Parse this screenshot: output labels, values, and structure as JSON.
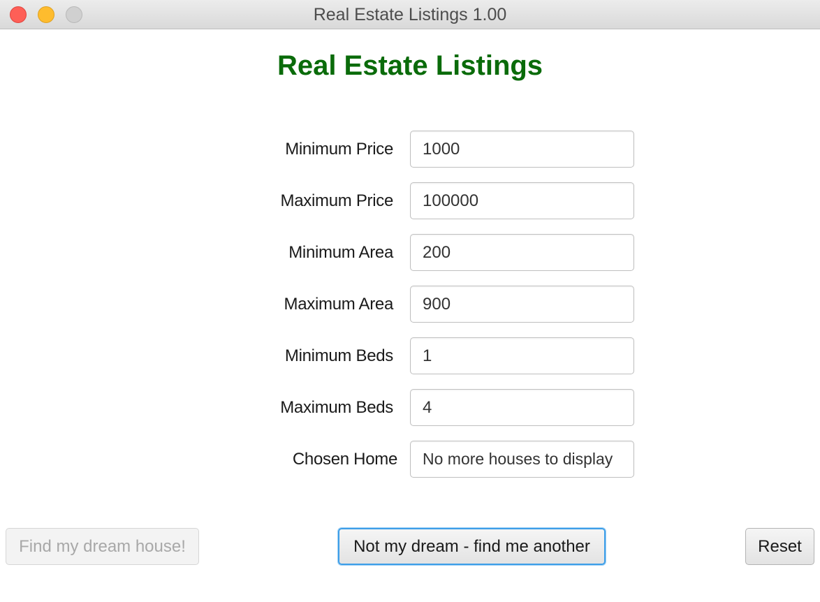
{
  "window": {
    "title": "Real Estate Listings 1.00"
  },
  "main": {
    "heading": "Real Estate Listings",
    "heading_color": "#0a6b0a"
  },
  "form": {
    "min_price": {
      "label": "Minimum Price",
      "value": "1000"
    },
    "max_price": {
      "label": "Maximum Price",
      "value": "100000"
    },
    "min_area": {
      "label": "Minimum Area",
      "value": "200"
    },
    "max_area": {
      "label": "Maximum Area",
      "value": "900"
    },
    "min_beds": {
      "label": "Minimum Beds",
      "value": "1"
    },
    "max_beds": {
      "label": "Maximum Beds",
      "value": "4"
    },
    "chosen_home": {
      "label": "Chosen Home",
      "value": "No more houses to display"
    }
  },
  "buttons": {
    "find_label": "Find my dream house!",
    "another_label": "Not my dream - find me another",
    "reset_label": "Reset"
  },
  "colors": {
    "focus_ring": "#3d9ee8",
    "close": "#fe5f57",
    "minimize": "#febc2e"
  }
}
